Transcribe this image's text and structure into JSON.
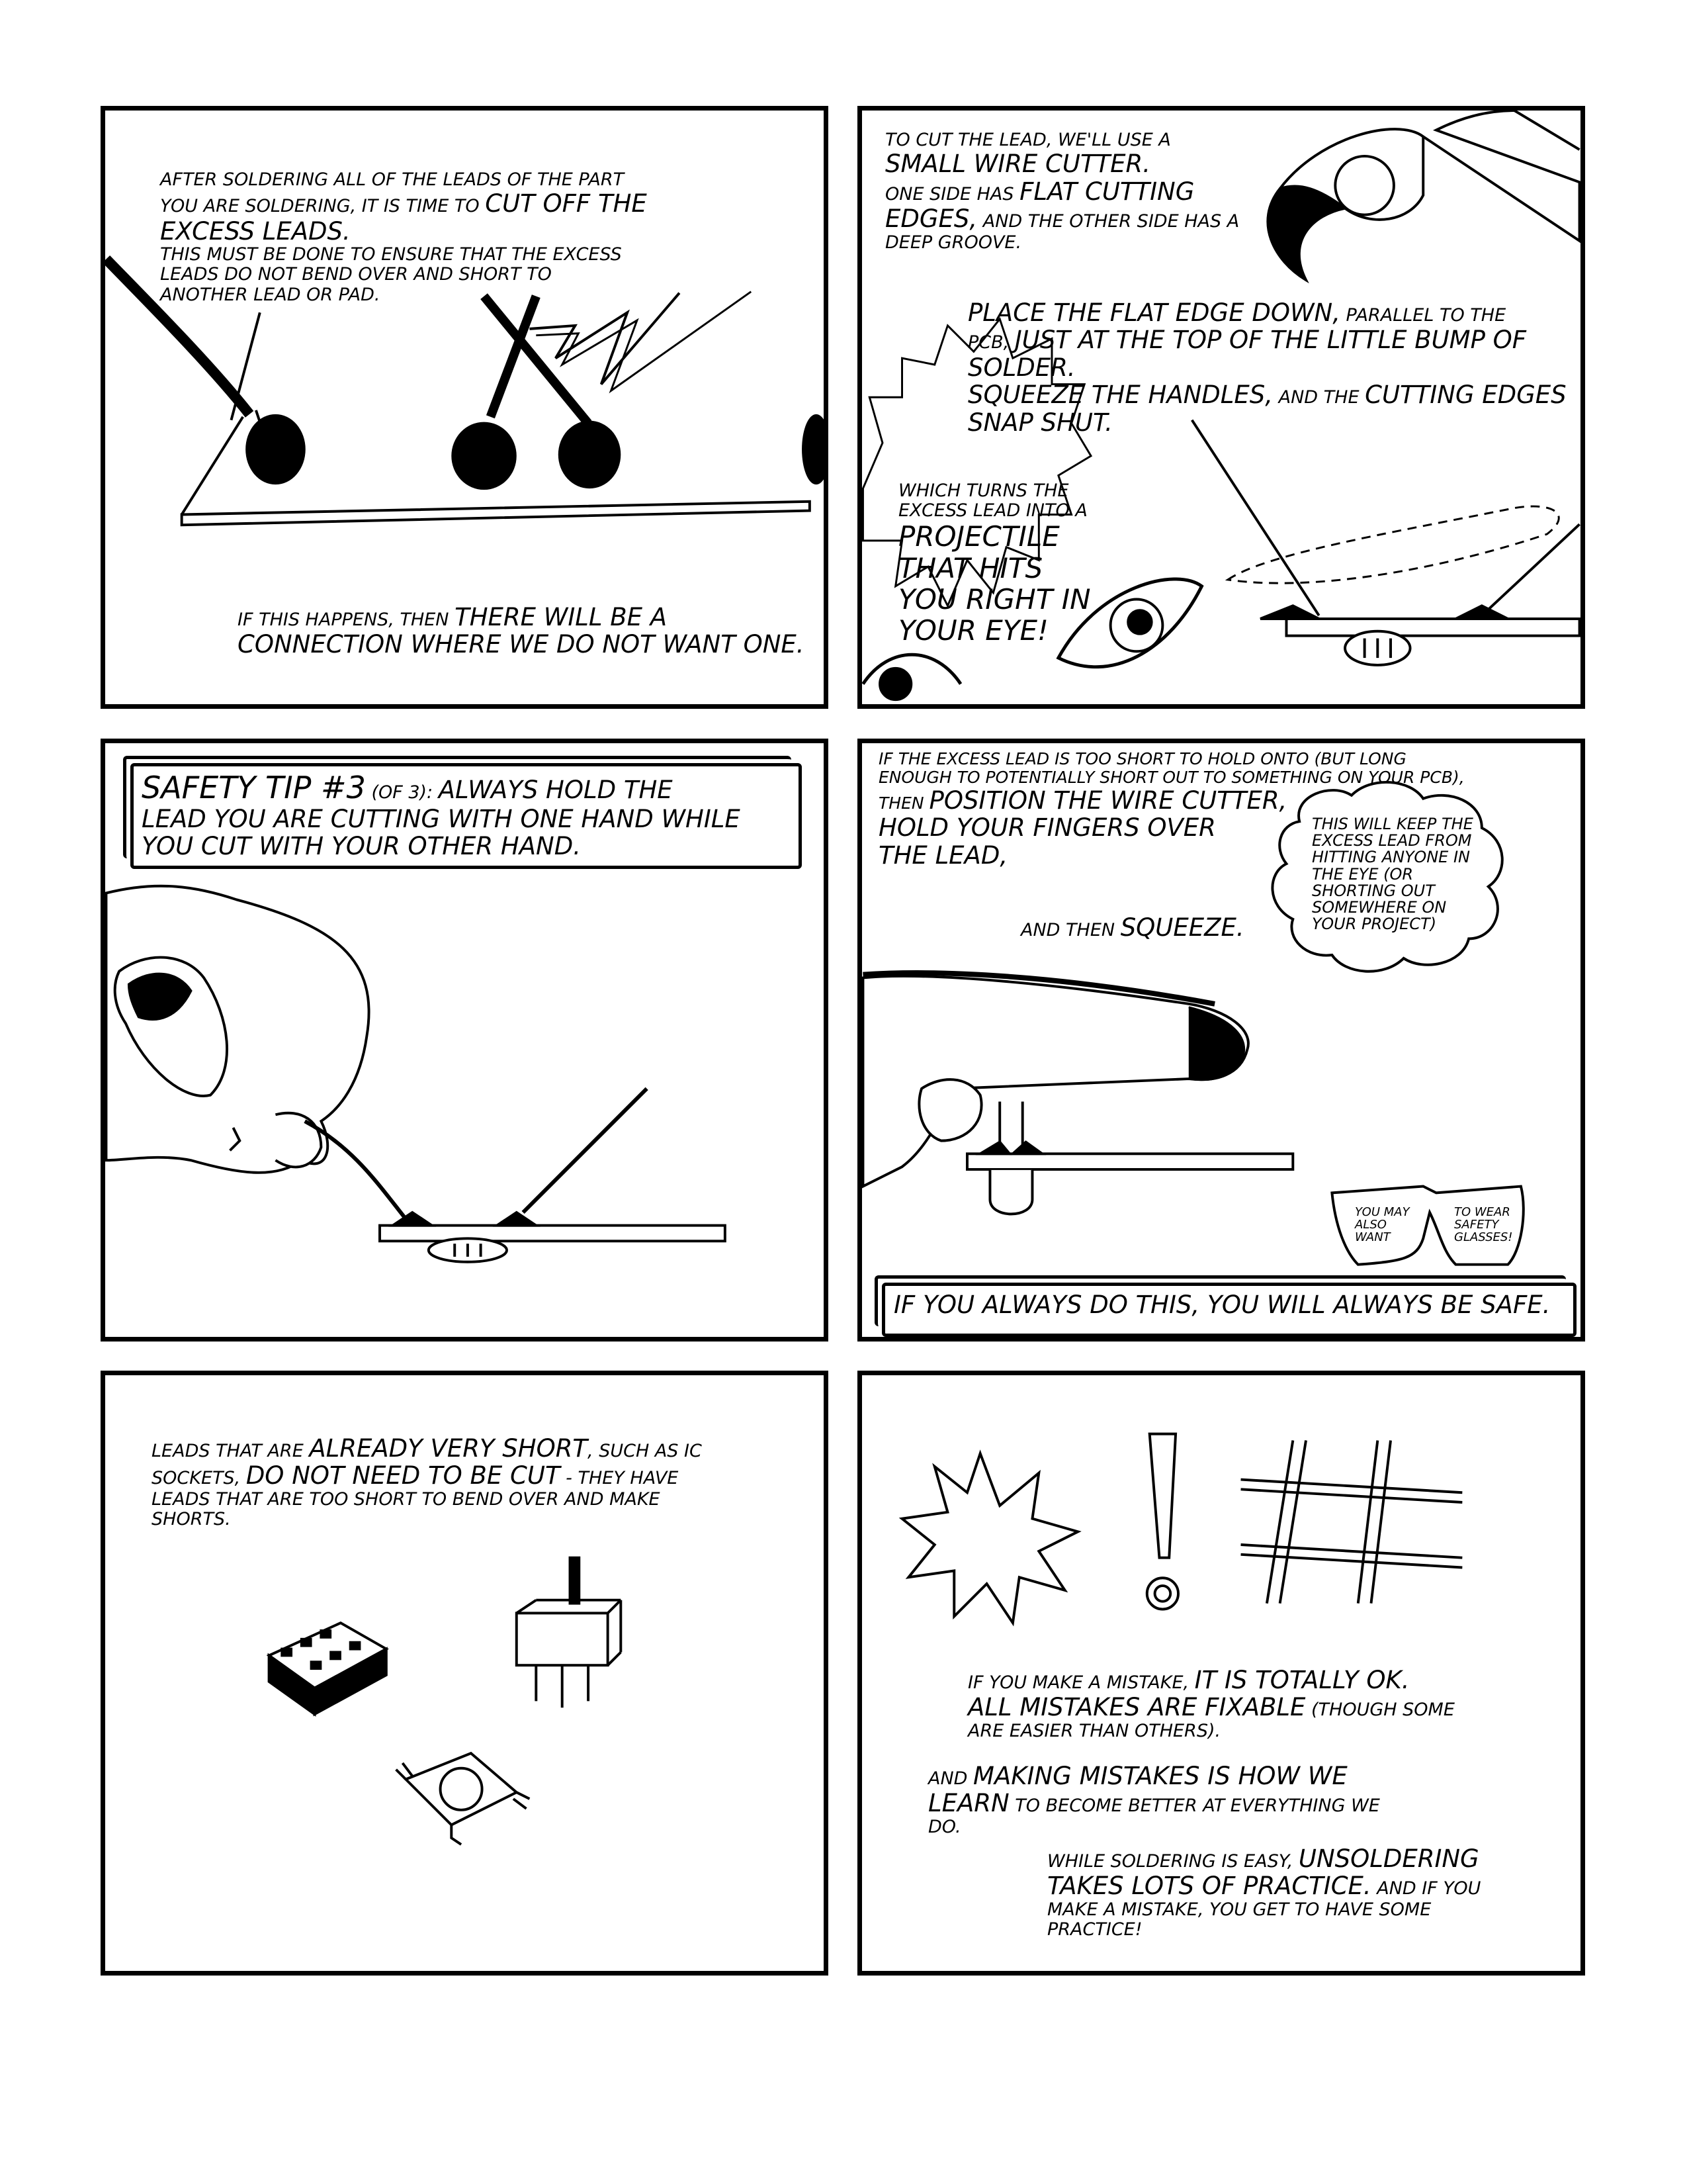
{
  "panels": {
    "p1": {
      "a1": "After soldering all of the leads of the part",
      "a2": "you are soldering, it is time to ",
      "a2b": "cut off the",
      "a3": "excess leads.",
      "a4": "This must be done to ",
      "a4b": "ensure that the excess",
      "a5": "leads do not bend over and short to",
      "a6": "another lead or pad.",
      "b1": "If this happens, then ",
      "b1b": "there will be a",
      "b2": "connection where we do not want one."
    },
    "p2": {
      "a1": "To cut the lead, we'll use a",
      "a2": "small wire cutter.",
      "a3": "One side has ",
      "a3b": "flat cutting",
      "a4": "edges,",
      "a4b": " and the other side has a",
      "a5": "deep groove.",
      "b1": "Place the flat edge down,",
      "b1b": " parallel to the",
      "b2": "PCB, ",
      "b2b": "just at the top of the little bump of",
      "b3": "solder.",
      "b4": "Squeeze the handles,",
      "b4b": " and the ",
      "b4c": "cutting edges",
      "b5": "snap shut.",
      "c1": "Which turns the",
      "c2": "excess lead into a",
      "c3": "projectile",
      "c4": "that hits",
      "c5": "you right in",
      "c6": "your eye!"
    },
    "p3": {
      "a1": "Safety Tip #3",
      "a1b": " (of 3): ",
      "a1c": " Always hold the",
      "a2": "lead you are cutting with one hand while",
      "a3": "you cut with your other hand."
    },
    "p4": {
      "a1": "If the excess lead is too short to hold onto (but long",
      "a2": "enough to potentially short out to something on your PCB),",
      "a3": "then ",
      "a3b": "position the wire cutter,",
      "a4": "hold your fingers over",
      "a5": "the lead,",
      "b1": "and then ",
      "b1b": "squeeze.",
      "c1": "This will keep the",
      "c2": "excess lead from",
      "c3": "hitting anyone in",
      "c4": "the eye (or",
      "c5": "shorting out",
      "c6": "somewhere on",
      "c7": "your project)",
      "g1": "You may",
      "g2": "also",
      "g3": "want",
      "g4": "to wear",
      "g5": "safety",
      "g6": "glasses!",
      "d1": "If you always do this, you will always be safe."
    },
    "p5": {
      "a1": "Leads that are ",
      "a1b": "already very short",
      "a1c": ", such as IC",
      "a2": "sockets, ",
      "a2b": "do not need to be cut",
      "a2c": " - they have",
      "a3": "leads that are too short to bend over and make",
      "a4": "shorts."
    },
    "p6": {
      "a1": "If you make a mistake, ",
      "a1b": "it is totally OK.",
      "a2": "All mistakes are fixable",
      "a2b": " (though some",
      "a3": "are easier than others).",
      "b1": "And ",
      "b1b": "making mistakes is how we",
      "b2": "learn",
      "b2b": " to become better at everything we",
      "b3": "do.",
      "c1": "While soldering is easy, ",
      "c1b": "unsoldering",
      "c2": "takes lots of practice.",
      "c2b": "  And if you",
      "c3": "make a mistake, you get to have some",
      "c4": "practice!"
    }
  },
  "icons": [
    "wire-cutter-icon",
    "eye-icon",
    "hand-icon",
    "pcb-icon",
    "safety-glasses-icon",
    "ic-socket-icon",
    "slide-switch-icon",
    "push-button-icon",
    "explosion-icon",
    "exclamation-icon",
    "hash-icon"
  ]
}
